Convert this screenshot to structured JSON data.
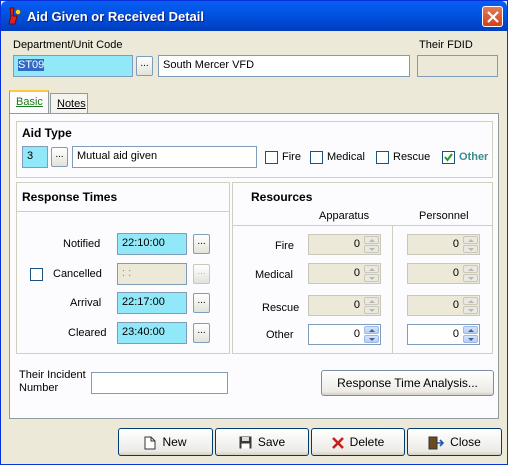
{
  "window": {
    "title": "Aid Given or Received Detail"
  },
  "header": {
    "dept_label": "Department/Unit Code",
    "dept_code": "ST09",
    "dept_name": "South Mercer VFD",
    "fdid_label": "Their FDID",
    "fdid_value": ""
  },
  "tabs": [
    {
      "label": "Basic",
      "active": true
    },
    {
      "label": "Notes",
      "active": false
    }
  ],
  "aid_type": {
    "heading": "Aid Type",
    "code": "3",
    "description": "Mutual aid given",
    "checks": [
      {
        "label": "Fire",
        "checked": false
      },
      {
        "label": "Medical",
        "checked": false
      },
      {
        "label": "Rescue",
        "checked": false
      },
      {
        "label": "Other",
        "checked": true
      }
    ]
  },
  "response_times": {
    "heading": "Response Times",
    "rows": [
      {
        "label": "Notified",
        "value": "22:10:00",
        "enabled": true
      },
      {
        "label": "Cancelled",
        "value": " : : ",
        "enabled": false
      },
      {
        "label": "Arrival",
        "value": "22:17:00",
        "enabled": true
      },
      {
        "label": "Cleared",
        "value": "23:40:00",
        "enabled": true
      }
    ]
  },
  "resources": {
    "heading": "Resources",
    "col_apparatus": "Apparatus",
    "col_personnel": "Personnel",
    "rows": [
      {
        "label": "Fire",
        "apparatus": "0",
        "personnel": "0",
        "enabled": false
      },
      {
        "label": "Medical",
        "apparatus": "0",
        "personnel": "0",
        "enabled": false
      },
      {
        "label": "Rescue",
        "apparatus": "0",
        "personnel": "0",
        "enabled": false
      },
      {
        "label": "Other",
        "apparatus": "0",
        "personnel": "0",
        "enabled": true
      }
    ]
  },
  "incident": {
    "label_line1": "Their Incident",
    "label_line2": "Number",
    "value": ""
  },
  "analysis_button": "Response Time Analysis...",
  "buttons": {
    "new": "New",
    "save": "Save",
    "delete": "Delete",
    "close": "Close"
  }
}
